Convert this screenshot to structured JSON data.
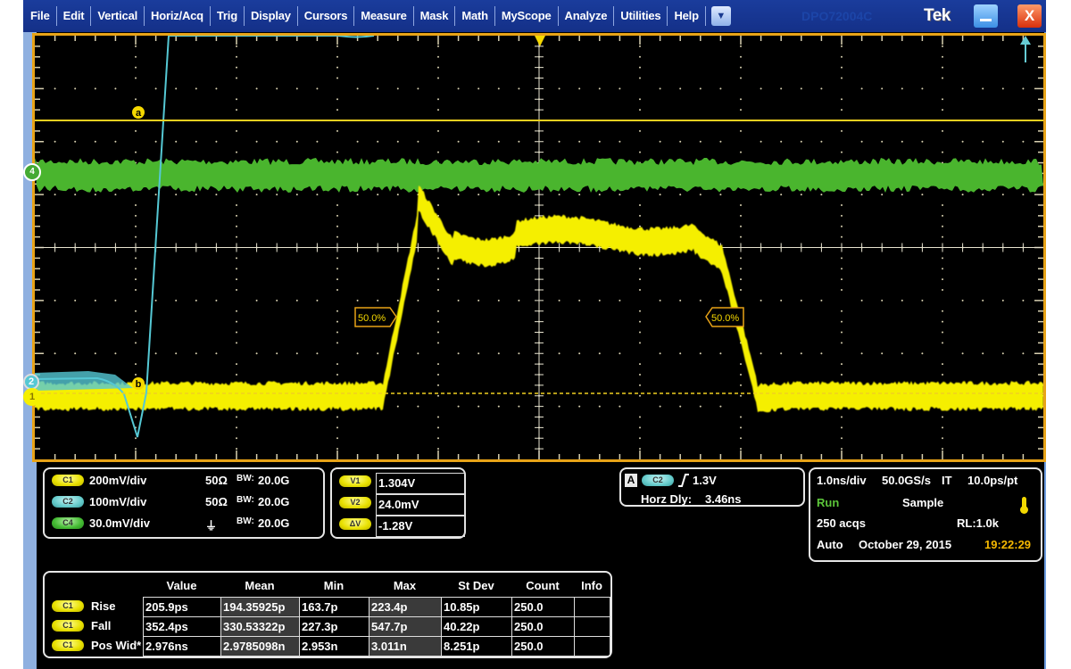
{
  "menubar": {
    "items": [
      "File",
      "Edit",
      "Vertical",
      "Horiz/Acq",
      "Trig",
      "Display",
      "Cursors",
      "Measure",
      "Mask",
      "Math",
      "MyScope",
      "Analyze",
      "Utilities",
      "Help"
    ],
    "dropdown_icon": "▼",
    "model": "DPO72004C",
    "brand": "Tek",
    "close_label": "X"
  },
  "display": {
    "colors": {
      "ch1": "#f5ef00",
      "ch2": "#55c8d4",
      "ch4": "#4ab52e",
      "graticule": "#e8a317",
      "grid": "#d8d0b0"
    },
    "markers": {
      "cursor_a": "a",
      "cursor_b": "b",
      "ch1_marker": "1",
      "ch2_marker": "2",
      "ch4_marker": "4"
    },
    "ref_level_left": "50.0%",
    "ref_level_right": "50.0%"
  },
  "channels": [
    {
      "tag": "C1",
      "scale": "200mV/div",
      "termination": "50Ω",
      "bw": "20.0G",
      "color": "yellow"
    },
    {
      "tag": "C2",
      "scale": "100mV/div",
      "termination": "50Ω",
      "bw": "20.0G",
      "color": "cyan"
    },
    {
      "tag": "C4",
      "scale": "30.0mV/div",
      "termination": "⏚",
      "bw": "20.0G",
      "color": "green"
    }
  ],
  "bw_prefix": "BW:",
  "cursors": [
    {
      "tag": "V1",
      "value": "1.304V"
    },
    {
      "tag": "V2",
      "value": "24.0mV"
    },
    {
      "tag": "ΔV",
      "value": "-1.28V"
    }
  ],
  "trigger": {
    "mode_badge": "A",
    "source": "C2",
    "slope": "rising",
    "level": "1.3V",
    "horz_dly_label": "Horz Dly:",
    "horz_dly_value": "3.46ns"
  },
  "acq": {
    "timebase": "1.0ns/div",
    "sample_rate": "50.0GS/s",
    "mode_it": "IT",
    "resolution": "10.0ps/pt",
    "run_state": "Run",
    "acq_mode": "Sample",
    "acqs": "250 acqs",
    "record_length": "RL:1.0k",
    "trigger_mode": "Auto",
    "date": "October 29, 2015",
    "time": "19:22:29"
  },
  "measurements": {
    "headers": [
      "Value",
      "Mean",
      "Min",
      "Max",
      "St Dev",
      "Count",
      "Info"
    ],
    "rows": [
      {
        "source": "C1",
        "name": "Rise",
        "cells": [
          "205.9ps",
          "194.35925p",
          "163.7p",
          "223.4p",
          "10.85p",
          "250.0",
          ""
        ]
      },
      {
        "source": "C1",
        "name": "Fall",
        "cells": [
          "352.4ps",
          "330.53322p",
          "227.3p",
          "547.7p",
          "40.22p",
          "250.0",
          ""
        ]
      },
      {
        "source": "C1",
        "name": "Pos Wid*",
        "cells": [
          "2.976ns",
          "2.9785098n",
          "2.953n",
          "3.011n",
          "8.251p",
          "250.0",
          ""
        ]
      }
    ]
  }
}
